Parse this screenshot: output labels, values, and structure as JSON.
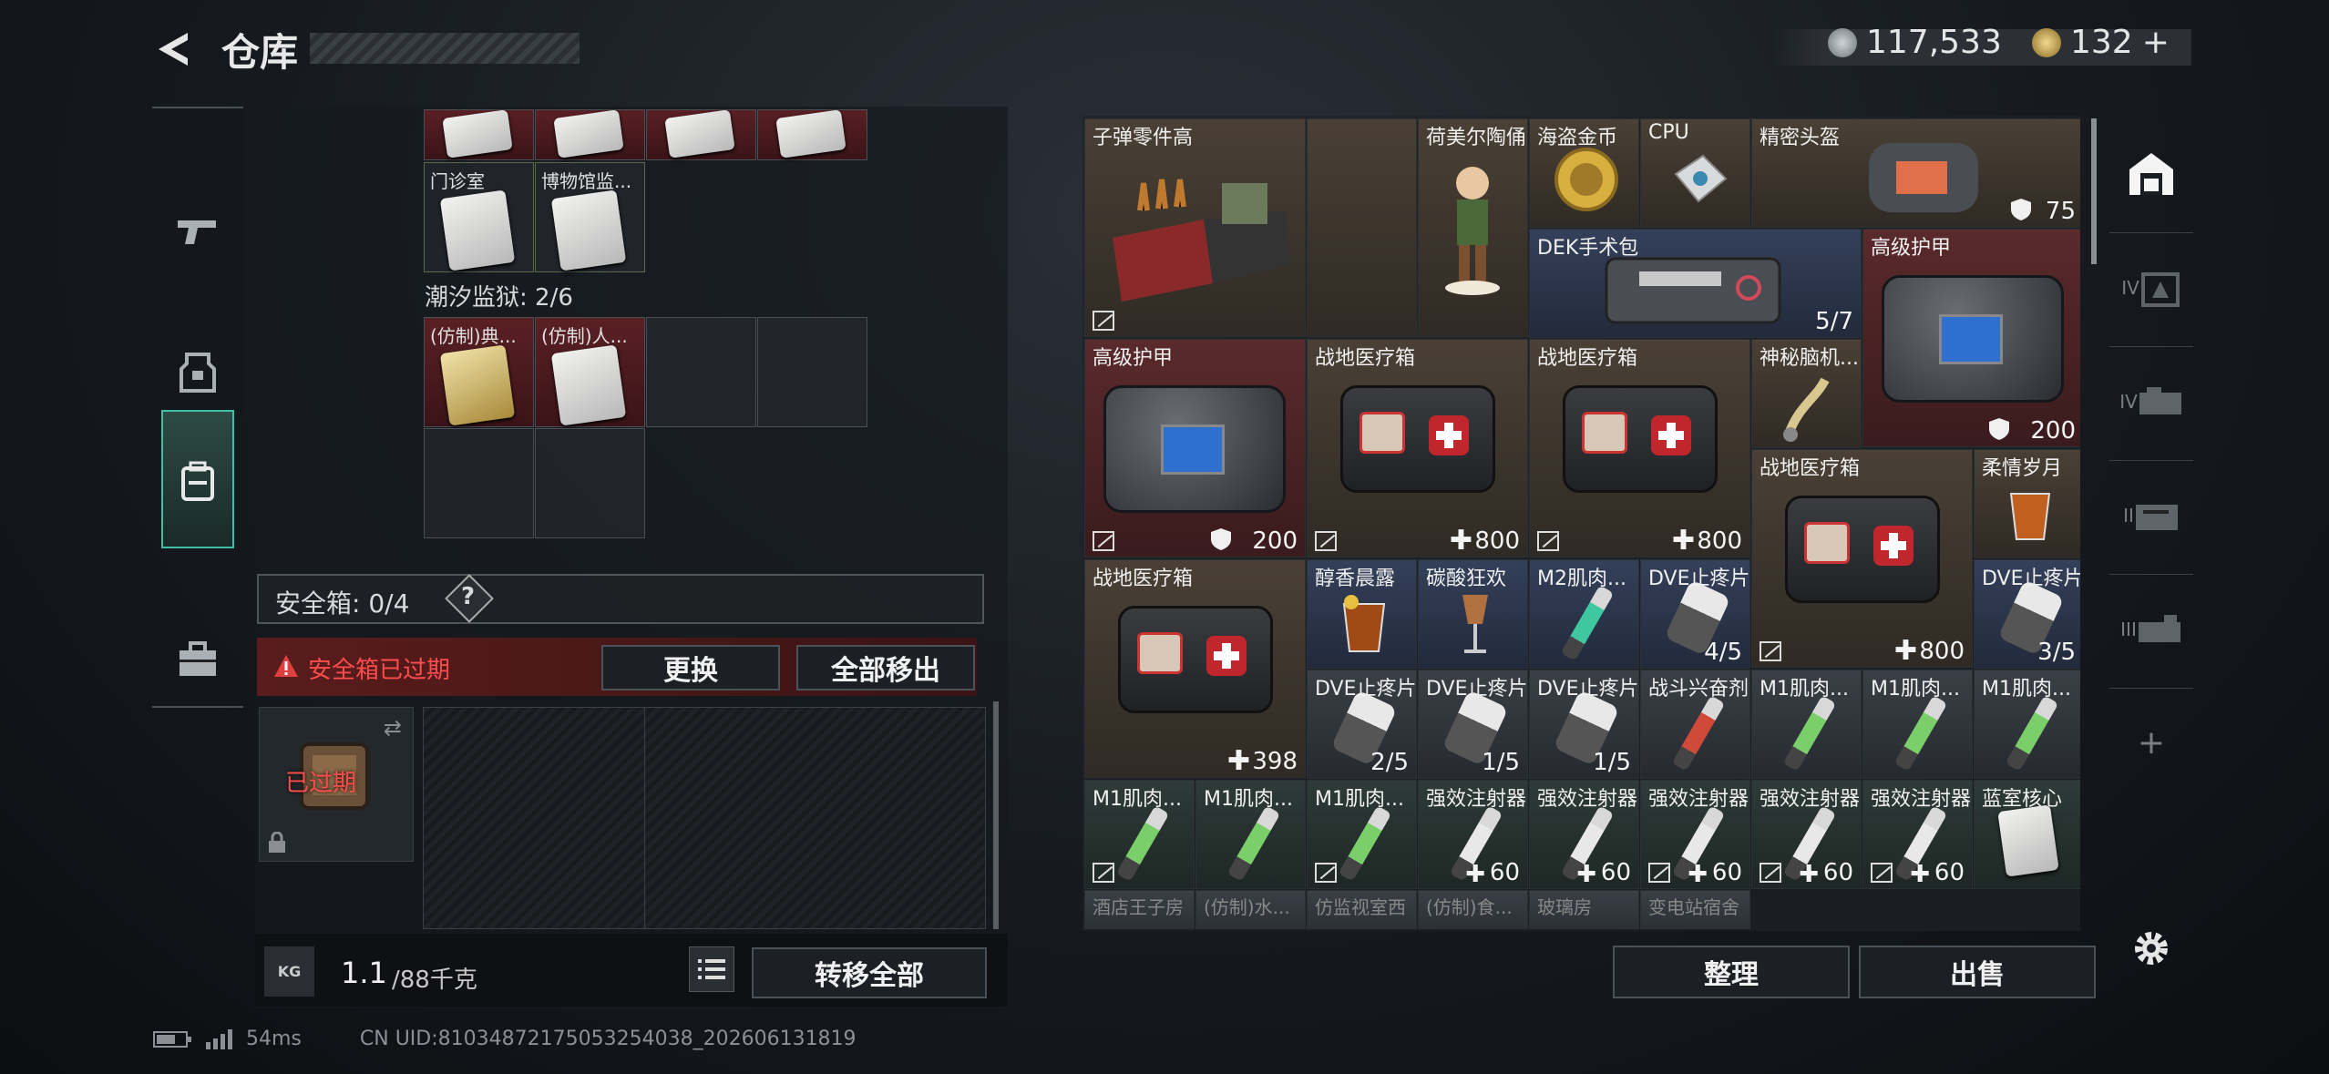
{
  "header": {
    "title": "仓库",
    "currency1": "117,533",
    "currency2": "132",
    "add_symbol": "+"
  },
  "left_nav": {
    "items": [
      "weapon",
      "gear",
      "backpack",
      "case"
    ]
  },
  "storage": {
    "row0_labels": [
      "",
      "",
      "",
      ""
    ],
    "row1_labels": [
      "门诊室",
      "博物馆监..."
    ],
    "prison_title": "潮汐监狱: 2/6",
    "prison_labels": [
      "(仿制)典...",
      "(仿制)人..."
    ]
  },
  "safe": {
    "label": "安全箱: 0/4",
    "help": "?",
    "expired_warning": "安全箱已过期",
    "replace_btn": "更换",
    "move_all_btn": "全部移出",
    "expired_badge": "已过期"
  },
  "weight": {
    "current": "1.1",
    "max": "/88千克",
    "kg_icon": "KG",
    "transfer_btn": "转移全部"
  },
  "inventory": {
    "items": {
      "bullet_parts": {
        "name": "子弹零件高"
      },
      "hummel": {
        "name": "荷美尔陶俑"
      },
      "pirate_coin": {
        "name": "海盗金币"
      },
      "cpu": {
        "name": "CPU"
      },
      "helmet": {
        "name": "精密头盔",
        "count": "75"
      },
      "dek": {
        "name": "DEK手术包",
        "count": "5/7"
      },
      "armor_a": {
        "name": "高级护甲",
        "count": "200"
      },
      "armor_b": {
        "name": "高级护甲",
        "count": "200"
      },
      "medkit_a": {
        "name": "战地医疗箱",
        "count": "800"
      },
      "medkit_b": {
        "name": "战地医疗箱",
        "count": "800"
      },
      "brain": {
        "name": "神秘脑机..."
      },
      "medkit_c": {
        "name": "战地医疗箱",
        "count": "800"
      },
      "tender": {
        "name": "柔情岁月"
      },
      "medkit_d": {
        "name": "战地医疗箱",
        "count": "398"
      },
      "morning": {
        "name": "醇香晨露"
      },
      "carbon": {
        "name": "碳酸狂欢"
      },
      "m2": {
        "name": "M2肌肉..."
      },
      "dve_a": {
        "name": "DVE止疼片",
        "count": "4/5"
      },
      "dve_b": {
        "name": "DVE止疼片",
        "count": "3/5"
      },
      "dve_c": {
        "name": "DVE止疼片",
        "count": "2/5"
      },
      "dve_d": {
        "name": "DVE止疼片",
        "count": "1/5"
      },
      "dve_e": {
        "name": "DVE止疼片",
        "count": "1/5"
      },
      "combat": {
        "name": "战斗兴奋剂"
      },
      "m1_a": {
        "name": "M1肌肉..."
      },
      "m1_b": {
        "name": "M1肌肉..."
      },
      "m1_c": {
        "name": "M1肌肉..."
      },
      "m1_d": {
        "name": "M1肌肉..."
      },
      "m1_e": {
        "name": "M1肌肉..."
      },
      "m1_f": {
        "name": "M1肌肉..."
      },
      "inj_a": {
        "name": "强效注射器",
        "count": "60"
      },
      "inj_b": {
        "name": "强效注射器",
        "count": "60"
      },
      "inj_c": {
        "name": "强效注射器",
        "count": "60"
      },
      "inj_d": {
        "name": "强效注射器",
        "count": "60"
      },
      "inj_e": {
        "name": "强效注射器",
        "count": "60"
      },
      "core": {
        "name": "蓝室核心"
      },
      "r_hotel": {
        "name": "酒店王子房"
      },
      "r_water": {
        "name": "(仿制)水..."
      },
      "r_prison": {
        "name": "仿监视室西"
      },
      "r_copy": {
        "name": "(仿制)食..."
      },
      "r_glass": {
        "name": "玻璃房"
      },
      "r_sub": {
        "name": "变电站宿舍"
      }
    },
    "sort_btn": "整理",
    "sell_btn": "出售"
  },
  "right_nav": {
    "tiers": [
      "IV",
      "IV",
      "II",
      "III"
    ],
    "add": "+"
  },
  "status": {
    "ping": "54ms",
    "uid": "CN UID:8103487217505325403​8_202606131819"
  }
}
